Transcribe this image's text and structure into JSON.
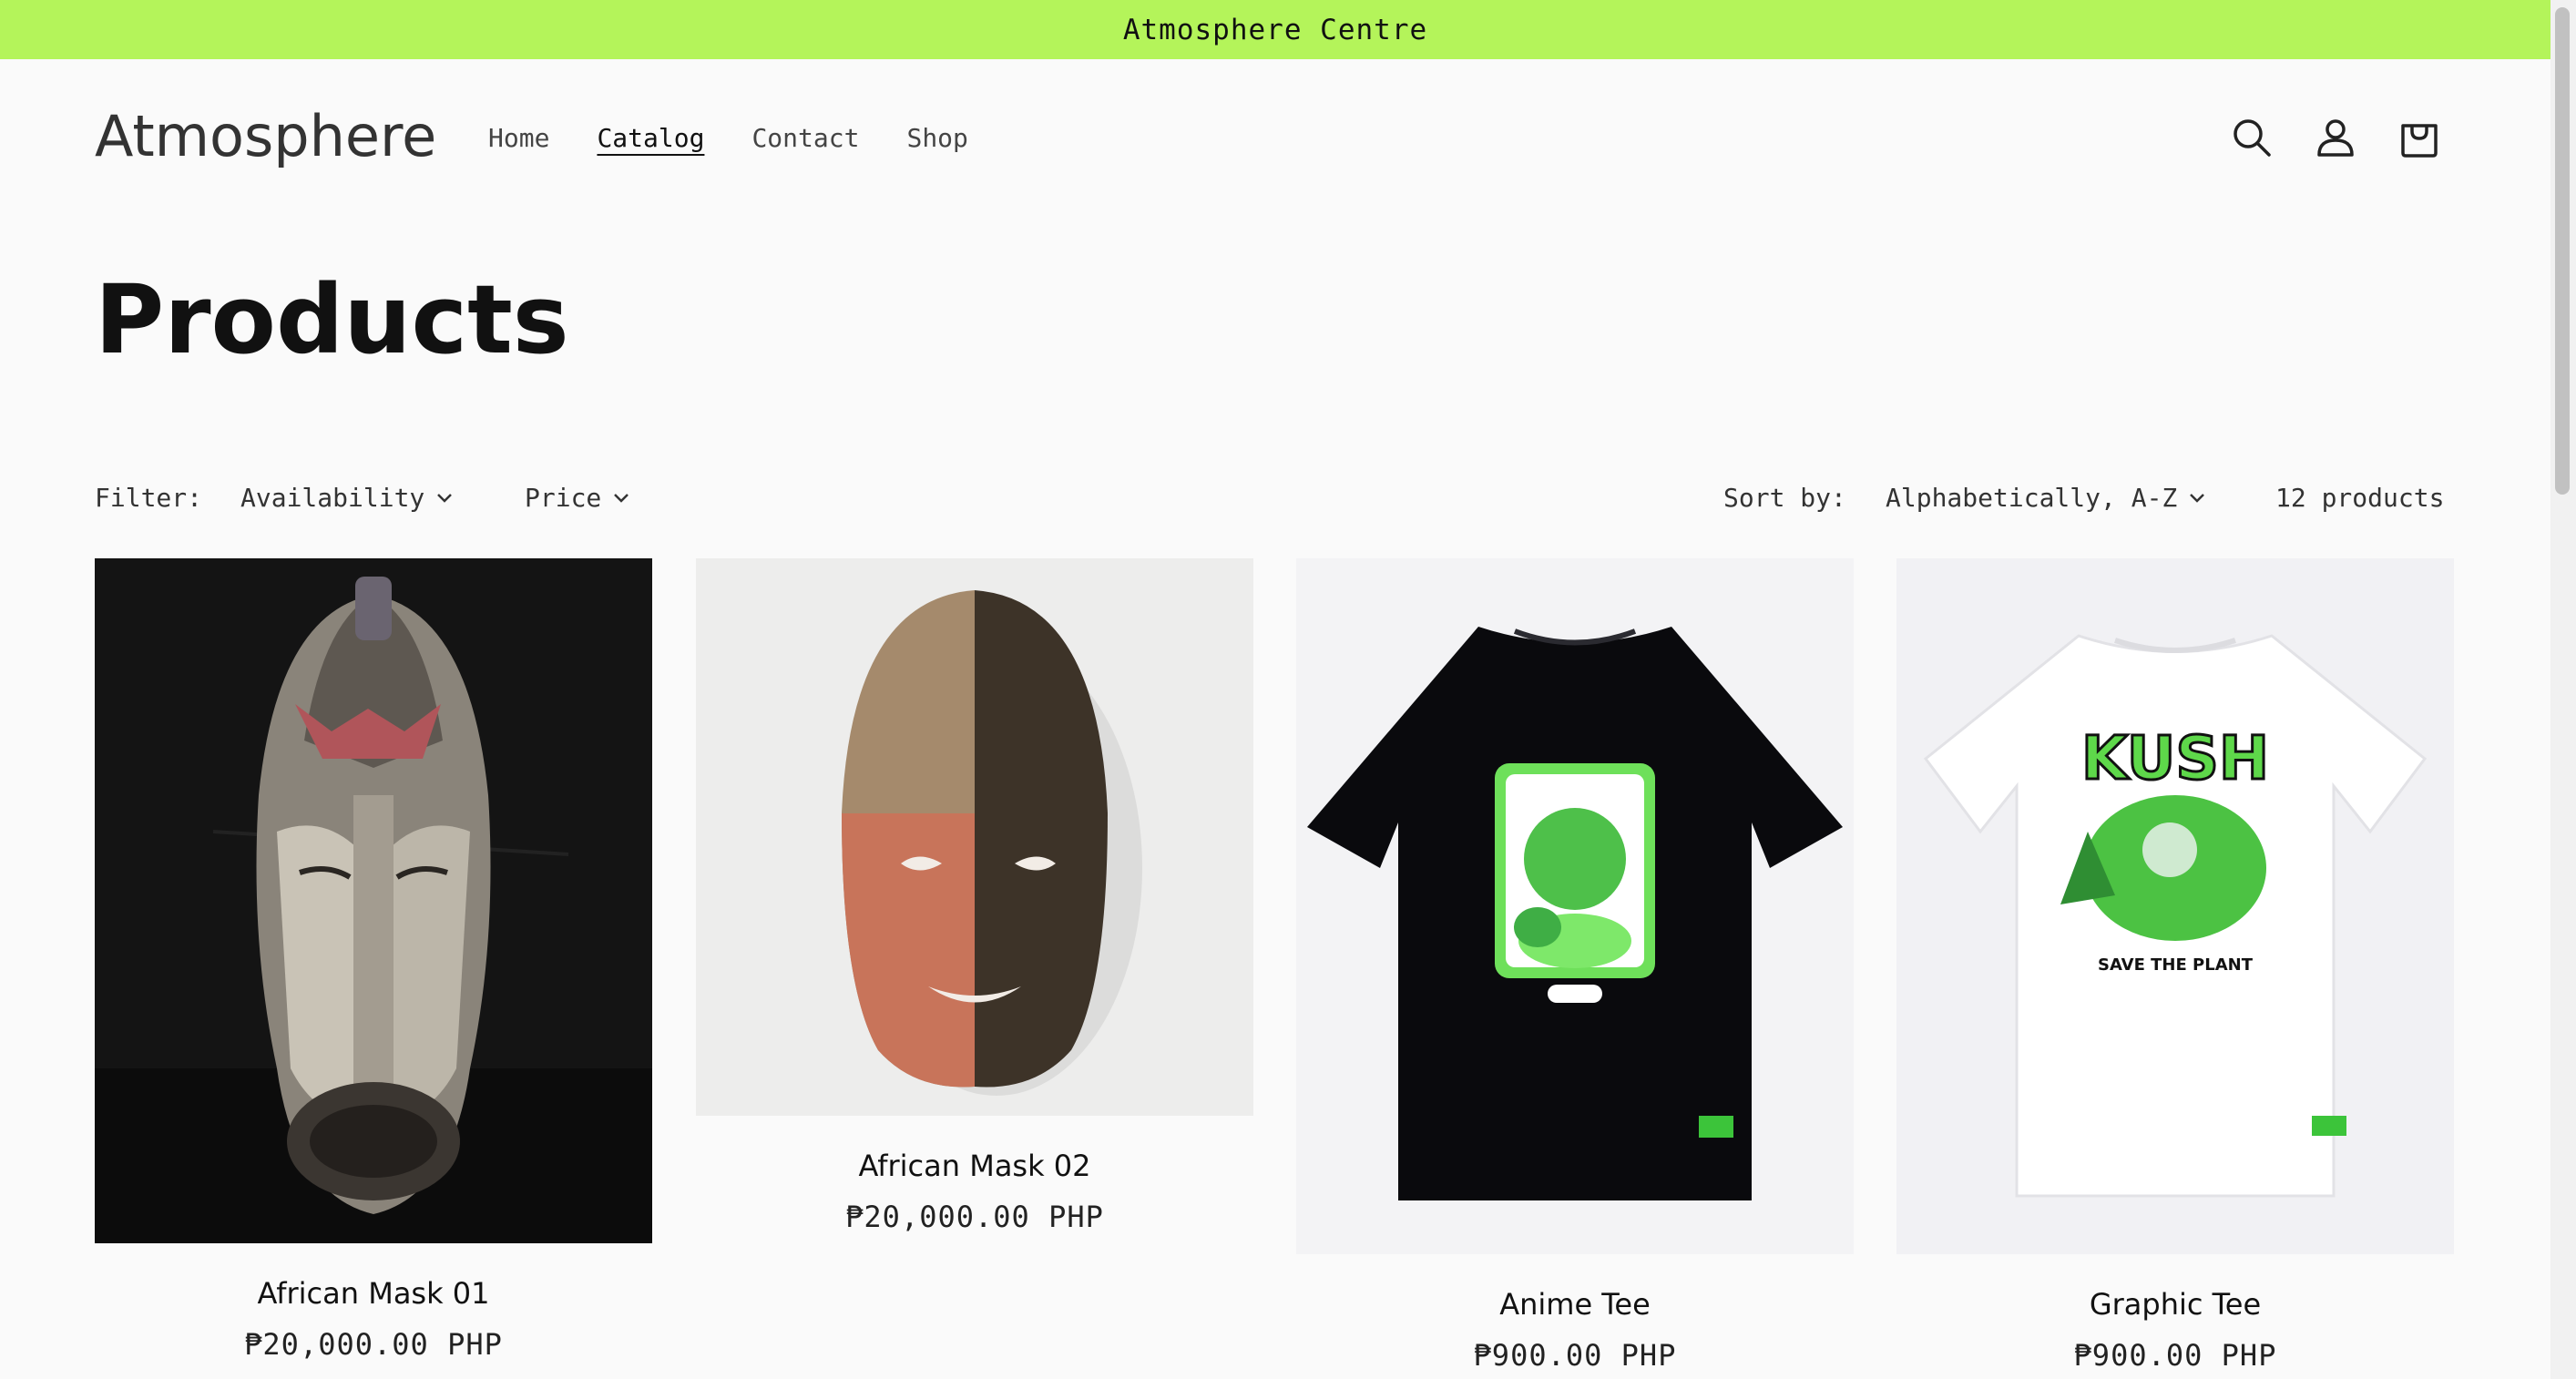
{
  "announcement": "Atmosphere Centre",
  "header": {
    "logo": "Atmosphere",
    "nav": [
      {
        "label": "Home"
      },
      {
        "label": "Catalog",
        "active": true
      },
      {
        "label": "Contact"
      },
      {
        "label": "Shop"
      }
    ],
    "icons": [
      "search-icon",
      "account-icon",
      "cart-icon"
    ]
  },
  "page_title": "Products",
  "filters": {
    "label": "Filter:",
    "availability": "Availability",
    "price": "Price",
    "sort_label": "Sort by:",
    "sort_value": "Alphabetically, A-Z",
    "count": "12 products"
  },
  "products": [
    {
      "name": "African Mask 01",
      "price": "₱20,000.00 PHP"
    },
    {
      "name": "African Mask 02",
      "price": "₱20,000.00 PHP"
    },
    {
      "name": "Anime Tee",
      "price": "₱900.00 PHP"
    },
    {
      "name": "Graphic Tee",
      "price": "₱900.00 PHP",
      "print_brand": "KUSH",
      "print_slogan": "SAVE THE PLANT"
    }
  ],
  "colors": {
    "announcement_bg": "#b4f45a",
    "background": "#fafafa",
    "accent_green": "#6ee05a"
  }
}
